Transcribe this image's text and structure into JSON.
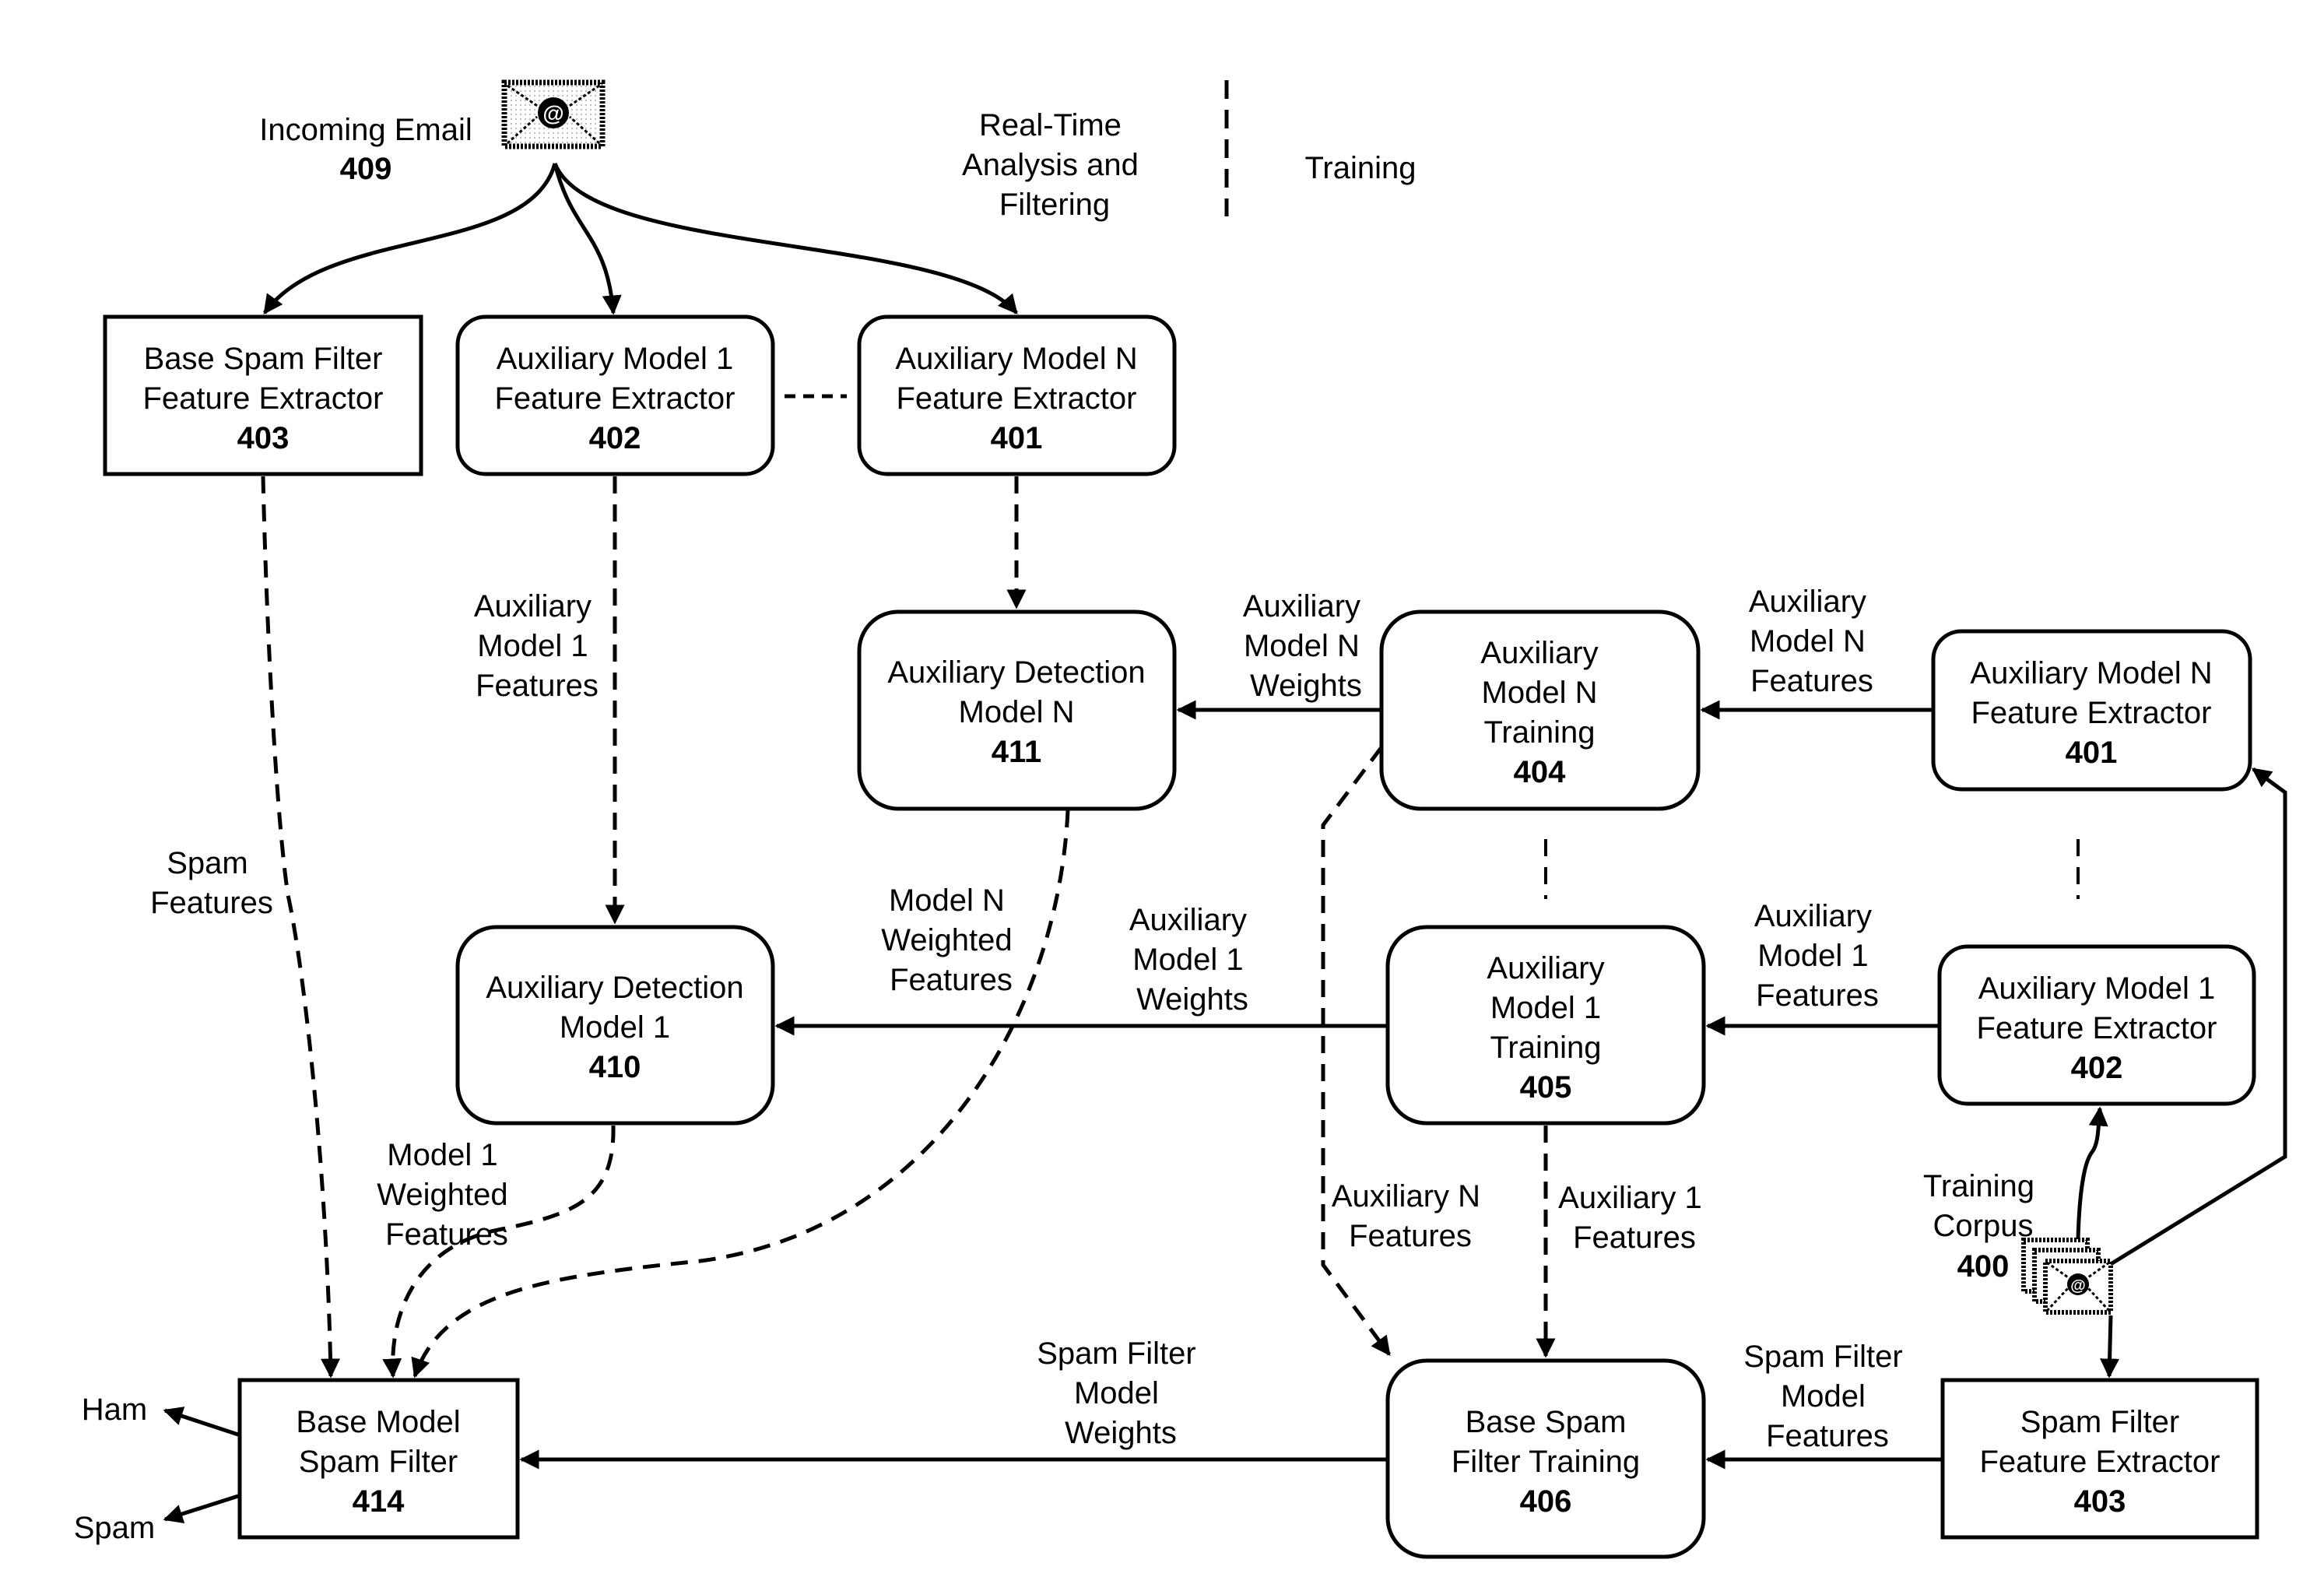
{
  "sections": {
    "realtime": [
      "Real-Time",
      "Analysis and",
      "Filtering"
    ],
    "training": "Training"
  },
  "incoming_email": {
    "label": "Incoming Email",
    "ref": "409",
    "icon": "email-icon"
  },
  "training_corpus": {
    "label": [
      "Training",
      "Corpus"
    ],
    "ref": "400",
    "icon": "email-stack-icon"
  },
  "outputs": {
    "ham": "Ham",
    "spam": "Spam"
  },
  "boxes": {
    "b403_left": {
      "lines": [
        "Base Spam Filter",
        "Feature Extractor"
      ],
      "ref": "403"
    },
    "b402_top": {
      "lines": [
        "Auxiliary Model 1",
        "Feature Extractor"
      ],
      "ref": "402"
    },
    "b401_top": {
      "lines": [
        "Auxiliary Model N",
        "Feature Extractor"
      ],
      "ref": "401"
    },
    "b411": {
      "lines": [
        "Auxiliary Detection",
        "Model N"
      ],
      "ref": "411"
    },
    "b404": {
      "lines": [
        "Auxiliary",
        "Model N",
        "Training"
      ],
      "ref": "404"
    },
    "b401_right": {
      "lines": [
        "Auxiliary Model N",
        "Feature Extractor"
      ],
      "ref": "401"
    },
    "b410": {
      "lines": [
        "Auxiliary Detection",
        "Model 1"
      ],
      "ref": "410"
    },
    "b405": {
      "lines": [
        "Auxiliary",
        "Model 1",
        "Training"
      ],
      "ref": "405"
    },
    "b402_right": {
      "lines": [
        "Auxiliary Model 1",
        "Feature Extractor"
      ],
      "ref": "402"
    },
    "b414": {
      "lines": [
        "Base Model",
        "Spam Filter"
      ],
      "ref": "414"
    },
    "b406": {
      "lines": [
        "Base Spam",
        "Filter Training"
      ],
      "ref": "406"
    },
    "b403_right": {
      "lines": [
        "Spam Filter",
        "Feature Extractor"
      ],
      "ref": "403"
    }
  },
  "edge_labels": {
    "aux1_features_top": [
      "Auxiliary",
      "Model 1",
      "Features"
    ],
    "spam_features": [
      "Spam",
      "Features"
    ],
    "auxN_weights": [
      "Auxiliary",
      "Model N",
      "Weights"
    ],
    "auxN_features": [
      "Auxiliary",
      "Model N",
      "Features"
    ],
    "modelN_weighted": [
      "Model N",
      "Weighted",
      "Features"
    ],
    "aux1_weights": [
      "Auxiliary",
      "Model 1",
      "Weights"
    ],
    "aux1_features_right": [
      "Auxiliary",
      "Model 1",
      "Features"
    ],
    "model1_weighted": [
      "Model 1",
      "Weighted",
      "Features"
    ],
    "auxN_features_bottom": [
      "Auxiliary N",
      "Features"
    ],
    "aux1_features_bottom": [
      "Auxiliary 1",
      "Features"
    ],
    "sf_model_weights": [
      "Spam Filter",
      "Model",
      "Weights"
    ],
    "sf_model_features": [
      "Spam Filter",
      "Model",
      "Features"
    ]
  }
}
